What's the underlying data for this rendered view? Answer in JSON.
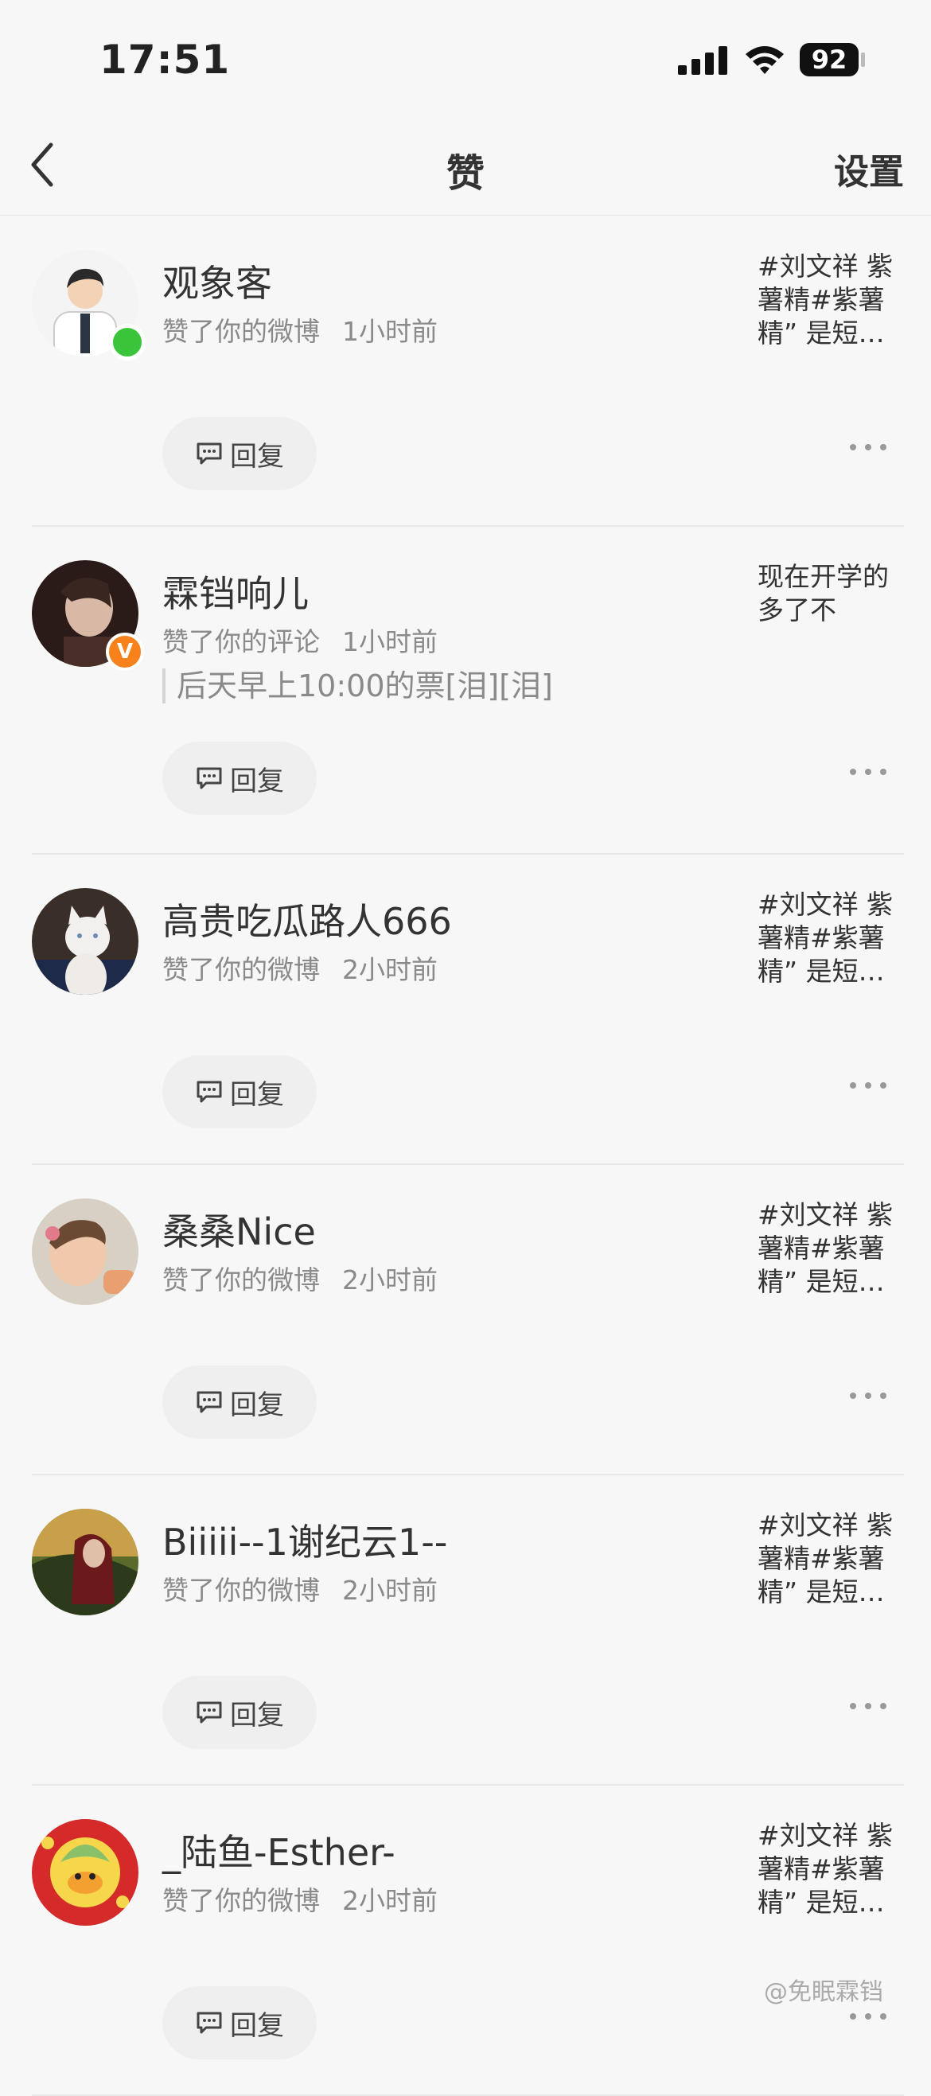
{
  "status": {
    "time": "17:51",
    "battery": "92"
  },
  "nav": {
    "title": "赞",
    "settings_label": "设置"
  },
  "reply_label": "回复",
  "items": [
    {
      "name": "观象客",
      "action": "赞了你的微博",
      "time": "1小时前",
      "preview": "#刘文祥 紫薯精#紫薯精” 是短…",
      "badge": "online"
    },
    {
      "name": "霖铛响儿",
      "action": "赞了你的评论",
      "time": "1小时前",
      "quote": "后天早上10:00的票[泪][泪]",
      "preview": "现在开学的多了不",
      "badge": "verified"
    },
    {
      "name": "高贵吃瓜路人666",
      "action": "赞了你的微博",
      "time": "2小时前",
      "preview": "#刘文祥 紫薯精#紫薯精” 是短…"
    },
    {
      "name": "桑桑Nice",
      "action": "赞了你的微博",
      "time": "2小时前",
      "preview": "#刘文祥 紫薯精#紫薯精” 是短…"
    },
    {
      "name": "Biiiii--1谢纪云1--",
      "action": "赞了你的微博",
      "time": "2小时前",
      "preview": "#刘文祥 紫薯精#紫薯精” 是短…"
    },
    {
      "name": "_陆鱼-Esther-",
      "action": "赞了你的微博",
      "time": "2小时前",
      "preview": "#刘文祥 紫薯精#紫薯精” 是短…"
    }
  ],
  "verified_badge_label": "V",
  "watermark": "@免眠霖铛",
  "colors": {
    "online": "#3ac43a",
    "verified": "#f7821b",
    "secondary_text": "#8a8a8a"
  }
}
